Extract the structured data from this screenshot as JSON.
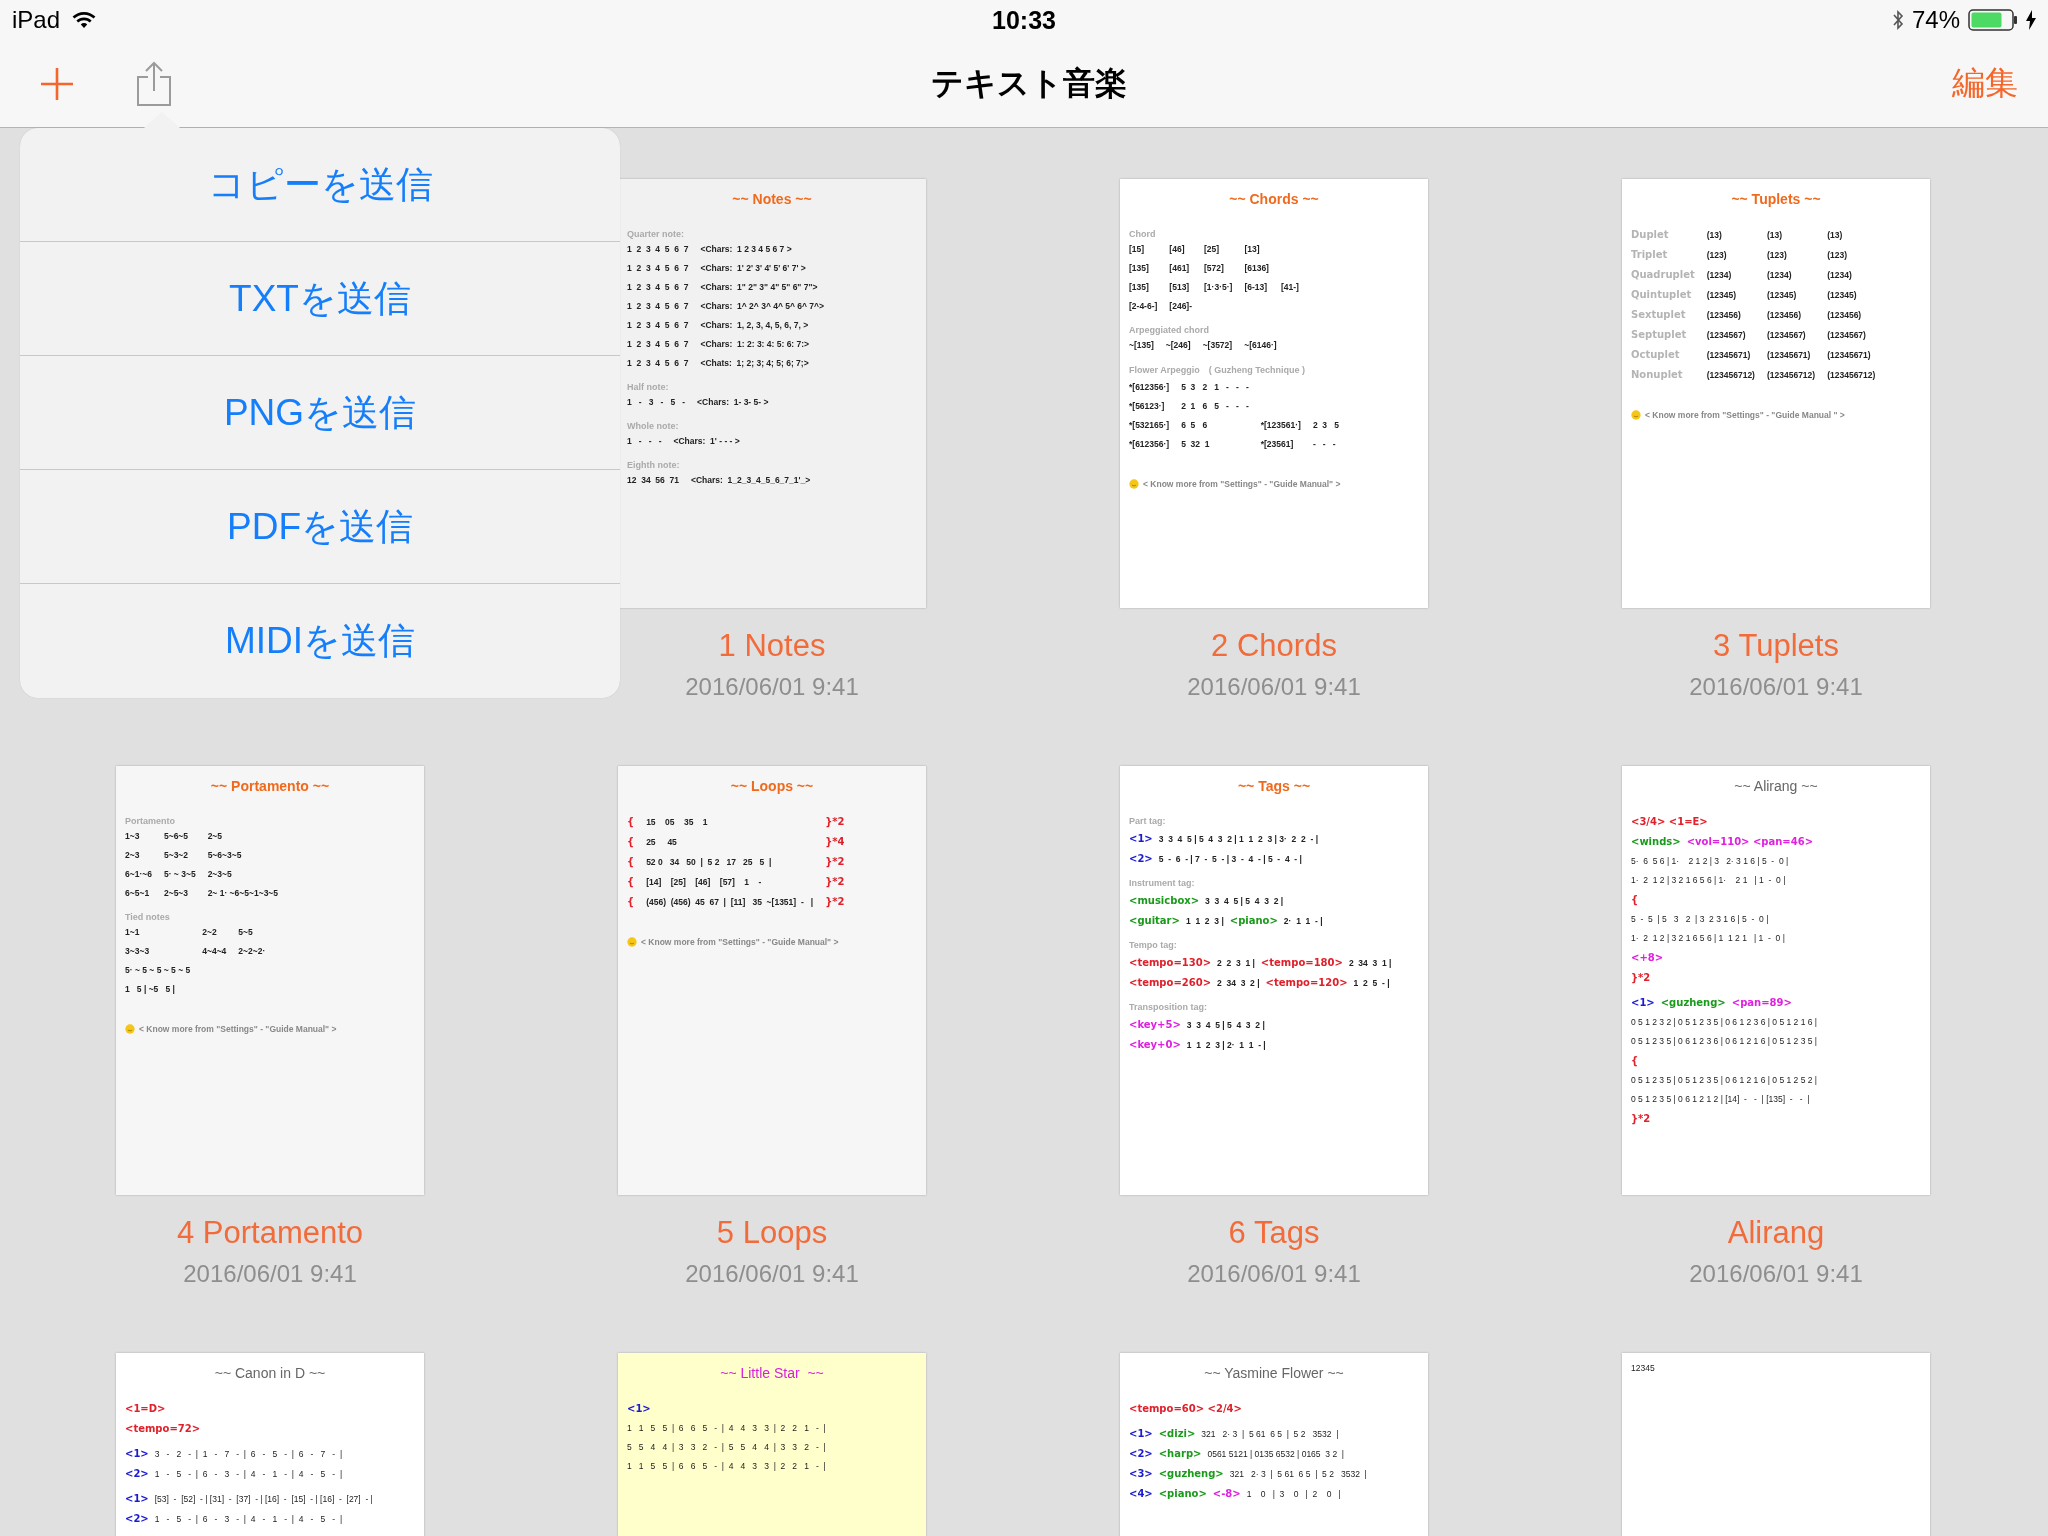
{
  "status_bar": {
    "device": "iPad",
    "time": "10:33",
    "battery": "74%"
  },
  "nav_bar": {
    "title": "テキスト音楽",
    "edit": "編集"
  },
  "share_menu": {
    "items": [
      "コピーを送信",
      "TXTを送信",
      "PNGを送信",
      "PDFを送信",
      "MIDIを送信"
    ]
  },
  "documents": [
    {
      "name": "1 Notes",
      "date": "2016/06/01 9:41",
      "page": {
        "color": "#f1f1f1",
        "heading": {
          "text": "~~ Notes ~~",
          "color": "#f06a1e",
          "bold": true
        },
        "sections": [
          {
            "kind": "table",
            "label": "Quarter note:",
            "rows": [
              [
                "1  2  3  4  5  6  7",
                "<Chars:  1 2 3 4 5 6 7 >"
              ],
              [
                "1  2  3  4  5  6  7",
                "<Chars:  1' 2' 3' 4' 5' 6' 7' >"
              ],
              [
                "1  2  3  4  5  6  7",
                "<Chars:  1\" 2\" 3\" 4\" 5\" 6\" 7\">"
              ],
              [
                "1  2  3  4  5  6  7",
                "<Chars:  1^ 2^ 3^ 4^ 5^ 6^ 7^>"
              ],
              [
                "1  2  3  4  5  6  7",
                "<Chars:  1, 2, 3, 4, 5, 6, 7, >"
              ],
              [
                "1  2  3  4  5  6  7",
                "<Chars:  1: 2: 3: 4: 5: 6: 7:>"
              ],
              [
                "1  2  3  4  5  6  7",
                "<Chats:  1; 2; 3; 4; 5; 6; 7;>"
              ]
            ]
          },
          {
            "kind": "table",
            "label": "Half note:",
            "rows": [
              [
                "1   -   3   -   5   -",
                "<Chars:  1- 3- 5- >"
              ]
            ]
          },
          {
            "kind": "table",
            "label": "Whole note:",
            "rows": [
              [
                "1   -   -   -",
                "<Chars:  1' - - - >"
              ]
            ]
          },
          {
            "kind": "table",
            "label": "Eighth note:",
            "rows": [
              [
                "12  34  56  71",
                "<Chars:  1_2_3_4_5_6_7_1'_>"
              ]
            ]
          }
        ]
      }
    },
    {
      "name": "2 Chords",
      "date": "2016/06/01 9:41",
      "page": {
        "color": "#ffffff",
        "heading": {
          "text": "~~ Chords ~~",
          "color": "#f06a1e",
          "bold": true
        },
        "sections": [
          {
            "kind": "table",
            "label": "Chord",
            "rows": [
              [
                "[15]",
                "[46]",
                "[25]",
                "[13]"
              ],
              [
                "[135]",
                "[461]",
                "[572]",
                "[6136]"
              ],
              [
                "[135]",
                "[513]",
                "[1·3·5·]",
                "[6-13]",
                "[41-]"
              ],
              [
                "[2-4-6-]",
                "[246]-"
              ]
            ]
          },
          {
            "kind": "table",
            "label": "Arpeggiated chord",
            "rows": [
              [
                "~[135]",
                "~[246]",
                "~[3572]",
                "~[6146·]"
              ]
            ]
          },
          {
            "kind": "table",
            "label": "Flower Arpeggio　( Guzheng Technique )",
            "rows": [
              [
                "*[612356·]",
                "5  3   2   1   -   -   -"
              ],
              [
                "*[56123·]",
                "2  1   6   5   -   -   -"
              ],
              [
                "*[532165·]",
                "6  5   6",
                "*[123561·]",
                "2  3   5"
              ],
              [
                "*[612356·]",
                "5  32  1",
                "*[23561]",
                "-   -   -"
              ]
            ]
          },
          {
            "kind": "footer",
            "text": "< Know more from \"Settings\" - \"Guide Manual\" >"
          }
        ]
      }
    },
    {
      "name": "3 Tuplets",
      "date": "2016/06/01 9:41",
      "page": {
        "color": "#ffffff",
        "heading": {
          "text": "~~ Tuplets ~~",
          "color": "#f06a1e",
          "bold": true
        },
        "sections": [
          {
            "kind": "table",
            "rows": [
              [
                {
                  "text": "Duplet",
                  "color": "#b4b4b4"
                },
                "(13)",
                "(13)",
                "(13)"
              ],
              [
                {
                  "text": "Triplet",
                  "color": "#b4b4b4"
                },
                "(123)",
                "(123)",
                "(123)"
              ],
              [
                {
                  "text": "Quadruplet",
                  "color": "#b4b4b4"
                },
                "(1234)",
                "(1234)",
                "(1234)"
              ],
              [
                {
                  "text": "Quintuplet",
                  "color": "#b4b4b4"
                },
                "(12345)",
                "(12345)",
                "(12345)"
              ],
              [
                {
                  "text": "Sextuplet",
                  "color": "#b4b4b4"
                },
                "(123456)",
                "(123456)",
                "(123456)"
              ],
              [
                {
                  "text": "Septuplet",
                  "color": "#b4b4b4"
                },
                "(1234567)",
                "(1234567)",
                "(1234567)"
              ],
              [
                {
                  "text": "Octuplet",
                  "color": "#b4b4b4"
                },
                "(12345671)",
                "(12345671)",
                "(12345671)"
              ],
              [
                {
                  "text": "Nonuplet",
                  "color": "#b4b4b4"
                },
                "(123456712)",
                "(123456712)",
                "(123456712)"
              ]
            ]
          },
          {
            "kind": "footer",
            "text": "< Know more from \"Settings\" - \"Guide Manual \" >"
          }
        ]
      }
    },
    {
      "name": "4 Portamento",
      "date": "2016/06/01 9:41",
      "page": {
        "color": "#f6f6f6",
        "heading": {
          "text": "~~ Portamento ~~",
          "color": "#f06a1e",
          "bold": true
        },
        "sections": [
          {
            "kind": "table",
            "label": "Portamento",
            "rows": [
              [
                "1~3",
                "5~6~5",
                "2~5"
              ],
              [
                "2~3",
                "5~3~2",
                "5~6~3~5"
              ],
              [
                "6~1·~6",
                "5· ~ 3~5",
                "2~3~5"
              ],
              [
                "6~5~1",
                "2~5~3",
                "2~ 1· ~6~5~1~3~5"
              ]
            ]
          },
          {
            "kind": "table",
            "label": "Tied notes",
            "rows": [
              [
                "1~1",
                "2~2",
                "5~5"
              ],
              [
                "3~3~3",
                "4~4~4",
                "2~2~2·"
              ],
              [
                "5· ~ 5 ~ 5 ~ 5 ~ 5"
              ],
              [
                "1   5 | ~5   5 |"
              ]
            ]
          },
          {
            "kind": "footer",
            "text": "< Know more from \"Settings\" - \"Guide Manual\" >"
          }
        ]
      }
    },
    {
      "name": "5 Loops",
      "date": "2016/06/01 9:41",
      "page": {
        "color": "#f6f6f6",
        "heading": {
          "text": "~~ Loops ~~",
          "color": "#f06a1e",
          "bold": true
        },
        "sections": [
          {
            "kind": "table",
            "rows": [
              [
                {
                  "text": "{",
                  "color": "#e0202a"
                },
                "15    05    35    1",
                {
                  "text": "}*2",
                  "color": "#e0202a"
                }
              ],
              [
                {
                  "text": "{",
                  "color": "#e0202a"
                },
                "25     45",
                {
                  "text": "}*4",
                  "color": "#e0202a"
                }
              ],
              [
                {
                  "text": "{",
                  "color": "#e0202a"
                },
                "52 0   34   50  |  5 2   17   25   5  |",
                {
                  "text": "}*2",
                  "color": "#e0202a"
                }
              ],
              [
                {
                  "text": "{",
                  "color": "#e0202a"
                },
                "[14]    [25]    [46]    [57]    1    -",
                {
                  "text": "}*2",
                  "color": "#e0202a"
                }
              ],
              [
                {
                  "text": "{",
                  "color": "#e0202a"
                },
                "(456)  (456)  45  67  |  [11]   35  ~[1351]  -   |",
                {
                  "text": "}*2",
                  "color": "#e0202a"
                }
              ]
            ]
          },
          {
            "kind": "footer",
            "text": "< Know more from \"Settings\" - \"Guide Manual\" >"
          }
        ]
      }
    },
    {
      "name": "6 Tags",
      "date": "2016/06/01 9:41",
      "page": {
        "color": "#ffffff",
        "heading": {
          "text": "~~ Tags ~~",
          "color": "#f06a1e",
          "bold": true
        },
        "sections": [
          {
            "kind": "lines",
            "label": "Part tag:",
            "rows": [
              [
                {
                  "text": "<1>",
                  "color": "#1a1ad0"
                },
                "3  3  4  5 | 5  4  3  2 | 1  1  2  3 | 3·  2  2  - |"
              ],
              [
                {
                  "text": "<2>",
                  "color": "#1a1ad0"
                },
                "5  -  6  - | 7  -  5  - | 3  -  4  - | 5  -  4  - |"
              ]
            ]
          },
          {
            "kind": "lines",
            "label": "Instrument tag:",
            "rows": [
              [
                {
                  "text": "<musicbox>",
                  "color": "#1a9a1a"
                },
                "3  3  4  5 | 5  4  3  2 |"
              ],
              [
                {
                  "text": "<guitar>",
                  "color": "#1a9a1a"
                },
                "1  1  2  3 |",
                {
                  "text": "<piano>",
                  "color": "#1a9a1a"
                },
                "2·  1  1  - |"
              ]
            ]
          },
          {
            "kind": "lines",
            "label": "Tempo tag:",
            "rows": [
              [
                {
                  "text": "<tempo=130>",
                  "color": "#e0202a"
                },
                "2  2  3  1 |",
                {
                  "text": "<tempo=180>",
                  "color": "#e0202a"
                },
                "2  34  3  1 |"
              ],
              [
                {
                  "text": "<tempo=260>",
                  "color": "#e0202a"
                },
                "2  34  3  2 |",
                {
                  "text": "<tempo=120>",
                  "color": "#e0202a"
                },
                "1  2  5  - |"
              ]
            ]
          },
          {
            "kind": "lines",
            "label": "Transposition tag:",
            "rows": [
              [
                {
                  "text": "<key+5>",
                  "color": "#e020e0"
                },
                "3  3  4  5 | 5  4  3  2 |"
              ],
              [
                {
                  "text": "<key+0>",
                  "color": "#e020e0"
                },
                "1  1  2  3 | 2·  1  1  - |"
              ]
            ]
          }
        ]
      }
    },
    {
      "name": "Alirang",
      "date": "2016/06/01 9:41",
      "page": {
        "color": "#ffffff",
        "heading": {
          "text": "~~ Alirang ~~",
          "color": "#666666",
          "bold": false
        },
        "sections": [
          {
            "kind": "lines",
            "rows": [
              [
                {
                  "text": "<3/4> <1=E>",
                  "color": "#e0202a"
                }
              ],
              [
                {
                  "text": "<winds>",
                  "color": "#1a9a1a"
                },
                {
                  "text": "<vol=110> <pan=46>",
                  "color": "#e020e0"
                }
              ],
              [
                "5·  6  5 6 | 1·    2 1 2 | 3   2· 3 1 6 | 5  -  0 |"
              ],
              [
                "1·  2  1 2 | 3 2 1 6 5 6 | 1·    2 1   | 1  -  0 |"
              ],
              [
                {
                  "text": "{",
                  "color": "#e0202a"
                }
              ],
              [
                "5  -  5  | 5   3   2  | 3  2 3 1 6 | 5  -  0 |"
              ],
              [
                "1·  2  1 2 | 3 2 1 6 5 6 | 1  1 2 1   | 1  -  0 |"
              ],
              [
                {
                  "text": "<+8>",
                  "color": "#e020e0"
                }
              ],
              [
                {
                  "text": "}*2",
                  "color": "#e0202a"
                }
              ]
            ]
          },
          {
            "kind": "lines",
            "rows": [
              [
                {
                  "text": "<1>",
                  "color": "#1a1ad0"
                },
                {
                  "text": "<guzheng>",
                  "color": "#1a9a1a"
                },
                {
                  "text": "<pan=89>",
                  "color": "#e020e0"
                }
              ],
              [
                "0 5 1 2 3 2 | 0 5 1 2 3 5 | 0 6 1 2 3 6 | 0 5 1 2 1 6 |"
              ],
              [
                "0 5 1 2 3 5 | 0 6 1 2 3 6 | 0 6 1 2 1 6 | 0 5 1 2 3 5 |"
              ],
              [
                {
                  "text": "{",
                  "color": "#e0202a"
                }
              ],
              [
                "0 5 1 2 3 5 | 0 5 1 2 3 5 | 0 6 1 2 1 6 | 0 5 1 2 5 2 |"
              ],
              [
                "0 5 1 2 3 5 | 0 6 1 2 1 2 | [14]  -   -  | [135]  -   -  |"
              ],
              [
                {
                  "text": "}*2",
                  "color": "#e0202a"
                }
              ]
            ]
          }
        ]
      }
    },
    {
      "page": {
        "color": "#ffffff",
        "heading": {
          "text": "~~ Canon in D ~~",
          "color": "#666666",
          "bold": false
        },
        "sections": [
          {
            "kind": "lines",
            "rows": [
              [
                {
                  "text": "<1=D>",
                  "color": "#e0202a"
                }
              ],
              [
                {
                  "text": "<tempo=72>",
                  "color": "#e0202a"
                }
              ]
            ]
          },
          {
            "kind": "lines",
            "rows": [
              [
                {
                  "text": "<1>",
                  "color": "#1a1ad0"
                },
                "3   -   2   -  |  1   -   7   -  |  6   -   5   -  |  6   -   7   -  |"
              ],
              [
                {
                  "text": "<2>",
                  "color": "#1a1ad0"
                },
                "1   -   5   -  |  6   -   3   -  |  4   -   1   -  |  4   -   5   -  |"
              ]
            ]
          },
          {
            "kind": "lines",
            "rows": [
              [
                {
                  "text": "<1>",
                  "color": "#1a1ad0"
                },
                "[53]  -  [52]  - | [31]  -  [37]  - | [16]  -  [15]  - | [16]  -  [27]  - |"
              ],
              [
                {
                  "text": "<2>",
                  "color": "#1a1ad0"
                },
                "1   -   5   -  |  6   -   3   -  |  4   -   1   -  |  4   -   5   -  |"
              ]
            ]
          }
        ]
      }
    },
    {
      "page": {
        "color": "#ffffcc",
        "heading": {
          "text": "~~ Little Star  ~~",
          "color": "#d81ed8",
          "bold": false
        },
        "sections": [
          {
            "kind": "lines",
            "rows": [
              [
                {
                  "text": "<1>",
                  "color": "#1a1ad0"
                }
              ],
              [
                "1   1   5   5  |  6   6   5   -  |  4   4   3   3  |  2   2   1   -  |"
              ],
              [
                "5   5   4   4  |  3   3   2   -  |  5   5   4   4  |  3   3   2   -  |"
              ],
              [
                "1   1   5   5  |  6   6   5   -  |  4   4   3   3  |  2   2   1   -  |"
              ]
            ]
          }
        ]
      }
    },
    {
      "page": {
        "color": "#ffffff",
        "heading": {
          "text": "~~ Yasmine Flower ~~",
          "color": "#666666",
          "bold": false
        },
        "sections": [
          {
            "kind": "lines",
            "rows": [
              [
                {
                  "text": "<tempo=60> <2/4>",
                  "color": "#e0202a"
                }
              ]
            ]
          },
          {
            "kind": "lines",
            "rows": [
              [
                {
                  "text": "<1>",
                  "color": "#1a1ad0"
                },
                {
                  "text": "<dizi>",
                  "color": "#1a9a1a"
                },
                "321   2· 3  |  5 61  6 5  |  5 2   3532  |"
              ],
              [
                {
                  "text": "<2>",
                  "color": "#1a1ad0"
                },
                {
                  "text": "<harp>",
                  "color": "#1a9a1a"
                },
                "0561 5121 | 0135 6532 | 0165  3 2  |"
              ],
              [
                {
                  "text": "<3>",
                  "color": "#1a1ad0"
                },
                {
                  "text": "<guzheng>",
                  "color": "#1a9a1a"
                },
                "321   2· 3  |  5 61  6 5  |  5 2   3532  |"
              ],
              [
                {
                  "text": "<4>",
                  "color": "#1a1ad0"
                },
                {
                  "text": "<piano>",
                  "color": "#1a9a1a"
                },
                {
                  "text": "<-8>",
                  "color": "#e020e0"
                },
                "1    0   |  3    0   |  2    0   |"
              ]
            ]
          }
        ]
      }
    },
    {
      "page": {
        "color": "#ffffff",
        "sections": [
          {
            "kind": "lines",
            "rows": [
              [
                "12345"
              ]
            ]
          }
        ]
      }
    }
  ]
}
